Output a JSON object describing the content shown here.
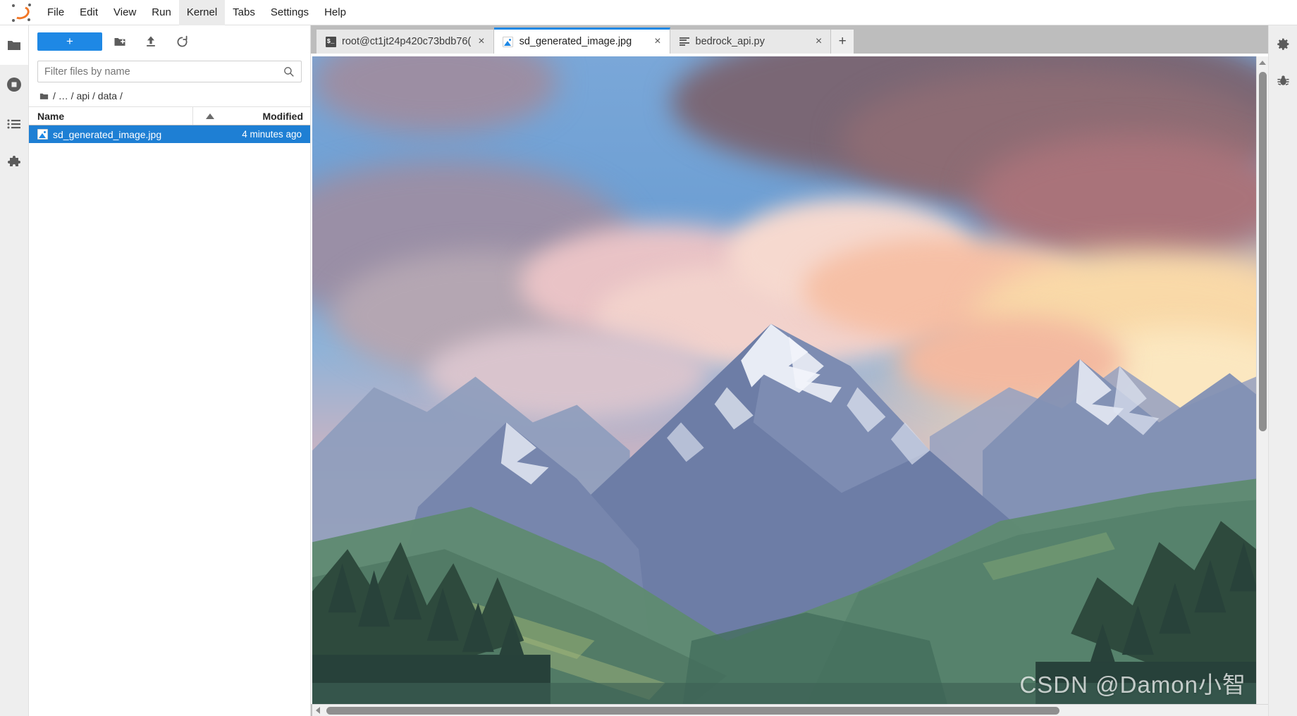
{
  "app": {
    "name": "JupyterLab",
    "logo_icon": "jupyter-logo-icon"
  },
  "menubar": {
    "items": [
      {
        "label": "File",
        "active": false
      },
      {
        "label": "Edit",
        "active": false
      },
      {
        "label": "View",
        "active": false
      },
      {
        "label": "Run",
        "active": false
      },
      {
        "label": "Kernel",
        "active": true
      },
      {
        "label": "Tabs",
        "active": false
      },
      {
        "label": "Settings",
        "active": false
      },
      {
        "label": "Help",
        "active": false
      }
    ]
  },
  "activitybar": {
    "items": [
      {
        "name": "file-browser",
        "icon": "folder-icon",
        "selected": true
      },
      {
        "name": "running-terminals-kernels",
        "icon": "stop-circle-icon",
        "selected": false
      },
      {
        "name": "commands",
        "icon": "list-icon",
        "selected": false
      },
      {
        "name": "extension-manager",
        "icon": "puzzle-icon",
        "selected": false
      }
    ]
  },
  "rightbar": {
    "items": [
      {
        "name": "property-inspector",
        "icon": "gear-icon"
      },
      {
        "name": "debugger",
        "icon": "bug-icon"
      }
    ]
  },
  "filebrowser": {
    "toolbar": {
      "new_launcher_label": "+",
      "new_folder_icon": "new-folder-icon",
      "upload_icon": "upload-icon",
      "refresh_icon": "refresh-icon"
    },
    "filter": {
      "placeholder": "Filter files by name",
      "value": "",
      "search_icon": "search-icon"
    },
    "breadcrumb": {
      "root_icon": "folder-icon",
      "parts": [
        "/",
        "…",
        "/",
        "api",
        "/",
        "data",
        "/"
      ],
      "text": "/ … / api / data /"
    },
    "columns": {
      "name": "Name",
      "modified": "Modified",
      "sort_icon": "sort-ascending-icon"
    },
    "rows": [
      {
        "name": "sd_generated_image.jpg",
        "modified": "4 minutes ago",
        "icon": "image-file-icon",
        "selected": true
      }
    ]
  },
  "tabbar": {
    "tabs": [
      {
        "label": "root@ct1jt24p420c73bdb76(",
        "icon": "terminal-icon",
        "active": false,
        "close_label": "×"
      },
      {
        "label": "sd_generated_image.jpg",
        "icon": "image-file-icon",
        "active": true,
        "close_label": "×"
      },
      {
        "label": "bedrock_api.py",
        "icon": "text-file-icon",
        "active": false,
        "close_label": "×"
      }
    ],
    "add_tab_label": "+"
  },
  "viewer": {
    "content_type": "image",
    "file_name": "sd_generated_image.jpg",
    "description": "Painted landscape: snow-capped mountain range under a blue sky with pink and mauve sunset clouds, green forested valley in the foreground",
    "watermark": "CSDN @Damon小智",
    "scrollbars": {
      "vertical_up_icon": "triangle-up-icon",
      "horizontal_left_icon": "triangle-left-icon"
    }
  },
  "colors": {
    "accent": "#1e88e5",
    "selection": "#1e7fd4",
    "brand_orange": "#f37726",
    "menu_active_bg": "#ebebeb",
    "tabbar_bg": "#bdbdbd",
    "sidebar_bg": "#eeeeee",
    "sky_blue": "#6fa0d4",
    "cloud_pink": "#f0bdb0",
    "cloud_mauve": "#8a7a8c",
    "mountain_blue": "#6b7fa8",
    "snow_white": "#dde4ef",
    "valley_green": "#5f8a6d",
    "forest_dark": "#2f4a3c",
    "sunset_gold": "#f5dfb0"
  }
}
